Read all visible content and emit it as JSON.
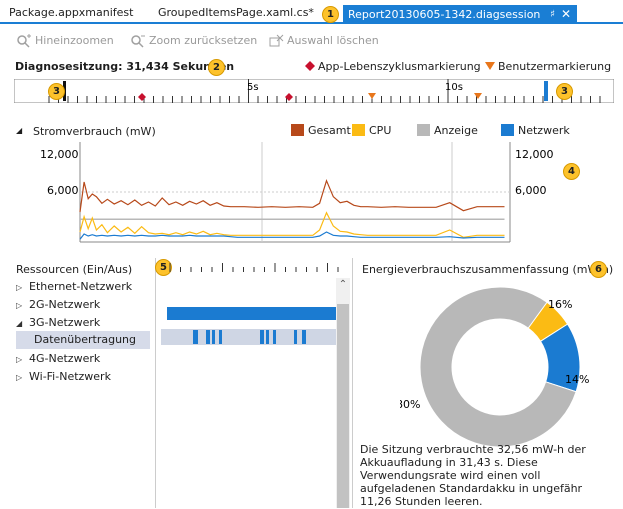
{
  "tabs": [
    {
      "label": "Package.appxmanifest"
    },
    {
      "label": "GroupedItemsPage.xaml.cs*"
    },
    {
      "label": "Report20130605-1342.diagsession",
      "active": true
    }
  ],
  "toolbar": {
    "zoom_in": "Hineinzoomen",
    "zoom_reset": "Zoom zurücksetzen",
    "clear_selection": "Auswahl löschen"
  },
  "session": {
    "label": "Diagnosesitzung: 31,434 Sekunden",
    "lifecycle_marker": "App-Lebenszyklusmarkierung",
    "user_marker": "Benutzermarkierung"
  },
  "ruler": {
    "ticks": [
      "5s",
      "10s"
    ]
  },
  "badges": [
    "1",
    "2",
    "3",
    "3",
    "4",
    "5",
    "6"
  ],
  "colors": {
    "accent": "#1a7ed4",
    "gesamt": "#b7491a",
    "cpu": "#fbbb14",
    "anzeige": "#b8b8b8",
    "netzwerk": "#1b7bd1",
    "lifecycle_marker": "#c8102e",
    "user_marker": "#e8761b",
    "badge": "#fdc22b"
  },
  "power": {
    "title": "Stromverbrauch (mW)",
    "legend": [
      "Gesamt",
      "CPU",
      "Anzeige",
      "Netzwerk"
    ],
    "y_ticks": [
      "12,000",
      "6,000"
    ]
  },
  "chart_data": {
    "type": "line",
    "title": "Stromverbrauch (mW)",
    "xlabel": "",
    "ylabel": "",
    "ylim": [
      0,
      15000
    ],
    "xlim": [
      0,
      31.4
    ],
    "x": [
      0,
      0.3,
      0.6,
      0.9,
      1.2,
      1.6,
      2.0,
      2.5,
      3.0,
      3.5,
      4.0,
      4.5,
      5.0,
      5.5,
      6.0,
      6.5,
      7.0,
      7.5,
      8.0,
      8.5,
      9.0,
      9.5,
      10.0,
      10.5,
      11.0,
      11.5,
      12.0,
      13.0,
      14.0,
      15.0,
      16.0,
      17.0,
      17.5,
      18.0,
      18.5,
      19.0,
      19.5,
      20.0,
      20.5,
      21.0,
      22.0,
      23.0,
      24.0,
      25.0,
      26.0,
      27.0,
      28.0,
      29.0,
      30.0,
      31.0
    ],
    "series": [
      {
        "name": "Gesamt",
        "values": [
          4500,
          9000,
          6500,
          7200,
          6800,
          5800,
          6400,
          5700,
          6200,
          5600,
          6300,
          5500,
          6000,
          5400,
          6600,
          5600,
          6000,
          5500,
          6100,
          5700,
          6200,
          5500,
          5900,
          5400,
          5300,
          5300,
          5300,
          5200,
          5300,
          5200,
          5300,
          5200,
          5800,
          9200,
          6800,
          5900,
          6100,
          5500,
          5300,
          5300,
          5200,
          5300,
          5200,
          5200,
          5200,
          5900,
          4700,
          5300,
          5300,
          5300
        ]
      },
      {
        "name": "CPU",
        "values": [
          1500,
          3800,
          2000,
          3600,
          1800,
          2600,
          1400,
          2400,
          1500,
          2200,
          1300,
          2300,
          1400,
          1200,
          1300,
          1100,
          1400,
          1100,
          1500,
          1200,
          1600,
          1100,
          1300,
          1100,
          1000,
          1000,
          1000,
          1000,
          1000,
          1000,
          1000,
          1000,
          1800,
          4400,
          2400,
          1600,
          1500,
          1200,
          1100,
          1000,
          1000,
          1000,
          1000,
          1000,
          1000,
          1800,
          700,
          1000,
          1000,
          1000
        ]
      },
      {
        "name": "Anzeige",
        "values": [
          3400,
          3400,
          3400,
          3400,
          3400,
          3400,
          3400,
          3400,
          3400,
          3400,
          3400,
          3400,
          3400,
          3400,
          3400,
          3400,
          3400,
          3400,
          3400,
          3400,
          3400,
          3400,
          3400,
          3400,
          3400,
          3400,
          3400,
          3400,
          3400,
          3400,
          3400,
          3400,
          3400,
          3400,
          3400,
          3400,
          3400,
          3400,
          3400,
          3400,
          3400,
          3400,
          3400,
          3400,
          3400,
          3400,
          3400,
          3400,
          3400,
          3400
        ]
      },
      {
        "name": "Netzwerk",
        "values": [
          400,
          1200,
          900,
          1100,
          900,
          1000,
          900,
          1000,
          900,
          1000,
          900,
          1000,
          900,
          900,
          1000,
          900,
          900,
          900,
          1000,
          900,
          900,
          900,
          900,
          900,
          800,
          700,
          700,
          700,
          700,
          700,
          700,
          700,
          900,
          1500,
          1000,
          900,
          900,
          800,
          700,
          700,
          700,
          700,
          700,
          700,
          700,
          800,
          600,
          700,
          700,
          700
        ]
      }
    ]
  },
  "resources": {
    "title": "Ressourcen (Ein/Aus)",
    "items": [
      {
        "label": "Ethernet-Netzwerk",
        "expanded": false
      },
      {
        "label": "2G-Netzwerk",
        "expanded": false
      },
      {
        "label": "3G-Netzwerk",
        "expanded": true
      },
      {
        "label": "Datenübertragung",
        "selected": true
      },
      {
        "label": "4G-Netzwerk",
        "expanded": false
      },
      {
        "label": "Wi-Fi-Netzwerk",
        "expanded": false
      }
    ]
  },
  "energy": {
    "title": "Energieverbrauchszusammenfassung (mW-h)",
    "slices": [
      {
        "name": "CPU",
        "percent": 16,
        "label": "16%"
      },
      {
        "name": "Netzwerk",
        "percent": 14,
        "label": "14%"
      },
      {
        "name": "Anzeige",
        "percent": 80,
        "label": "80%"
      }
    ],
    "summary": "Die Sitzung verbrauchte 32,56 mW-h der Akkuaufladung in 31,43 s. Diese Verwendungsrate wird einen voll aufgeladenen Standardakku in ungefähr 11,26 Stunden leeren."
  }
}
